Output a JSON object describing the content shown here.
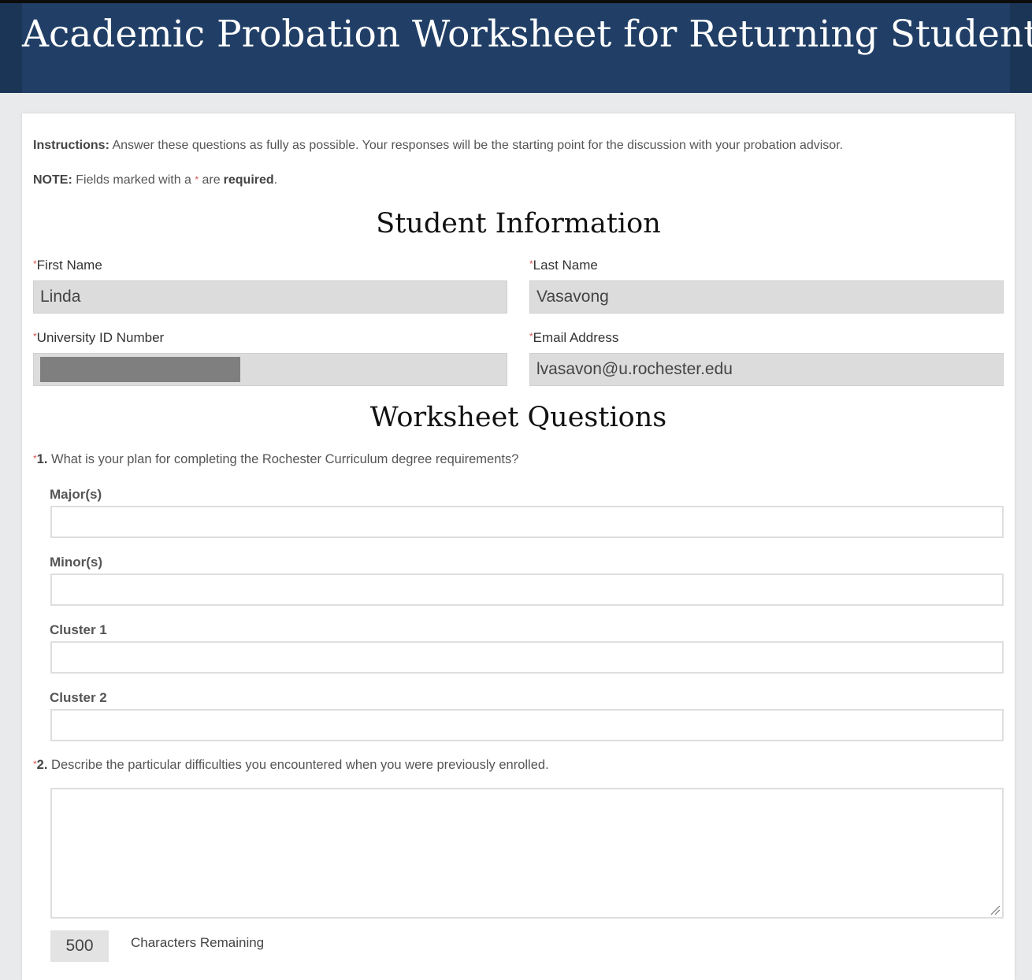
{
  "header": {
    "title": "Academic Probation Worksheet for Returning Students"
  },
  "instructions": {
    "label": "Instructions:",
    "text": "Answer these questions as fully as possible. Your responses will be the starting point for the discussion with your probation advisor."
  },
  "note": {
    "label": "NOTE:",
    "text_before": "Fields marked with a",
    "star": "*",
    "text_middle": "are",
    "emphasis": "required",
    "text_after": "."
  },
  "student_info": {
    "heading": "Student Information",
    "first_name": {
      "label": "First Name",
      "value": "Linda"
    },
    "last_name": {
      "label": "Last Name",
      "value": "Vasavong"
    },
    "university_id": {
      "label": "University ID Number",
      "value": ""
    },
    "email": {
      "label": "Email Address",
      "value": "lvasavon@u.rochester.edu"
    }
  },
  "worksheet": {
    "heading": "Worksheet Questions",
    "q1": {
      "number": "1.",
      "text": "What is your plan for completing the Rochester Curriculum degree requirements?",
      "majors_label": "Major(s)",
      "minors_label": "Minor(s)",
      "cluster1_label": "Cluster 1",
      "cluster2_label": "Cluster 2"
    },
    "q2": {
      "number": "2.",
      "text": "Describe the particular difficulties you encountered when you were previously enrolled.",
      "chars_remaining": "500",
      "chars_label": "Characters Remaining"
    }
  },
  "required_star": "*",
  "colors": {
    "banner": "#213f66",
    "required": "#d9534f",
    "field_bg": "#dcdcdc",
    "redaction": "#7f7f7f"
  }
}
